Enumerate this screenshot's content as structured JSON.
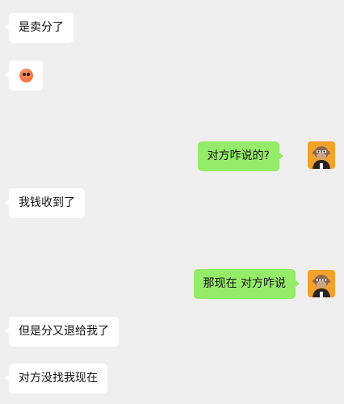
{
  "messages": [
    {
      "side": "left",
      "type": "text",
      "text": "是卖分了"
    },
    {
      "side": "left",
      "type": "emoji",
      "emoji": "orange-face-emoji"
    },
    {
      "side": "right",
      "type": "text",
      "text": "对方咋说的?"
    },
    {
      "side": "left",
      "type": "text",
      "text": "我钱收到了"
    },
    {
      "side": "right",
      "type": "text",
      "text": "那现在 对方咋说"
    },
    {
      "side": "left",
      "type": "text",
      "text": "但是分又退给我了"
    },
    {
      "side": "left",
      "type": "text",
      "text": "对方没找我现在"
    }
  ],
  "colors": {
    "background": "#efefef",
    "incoming_bubble": "#ffffff",
    "outgoing_bubble": "#95ec69",
    "avatar_bg": "#f2a12b"
  }
}
